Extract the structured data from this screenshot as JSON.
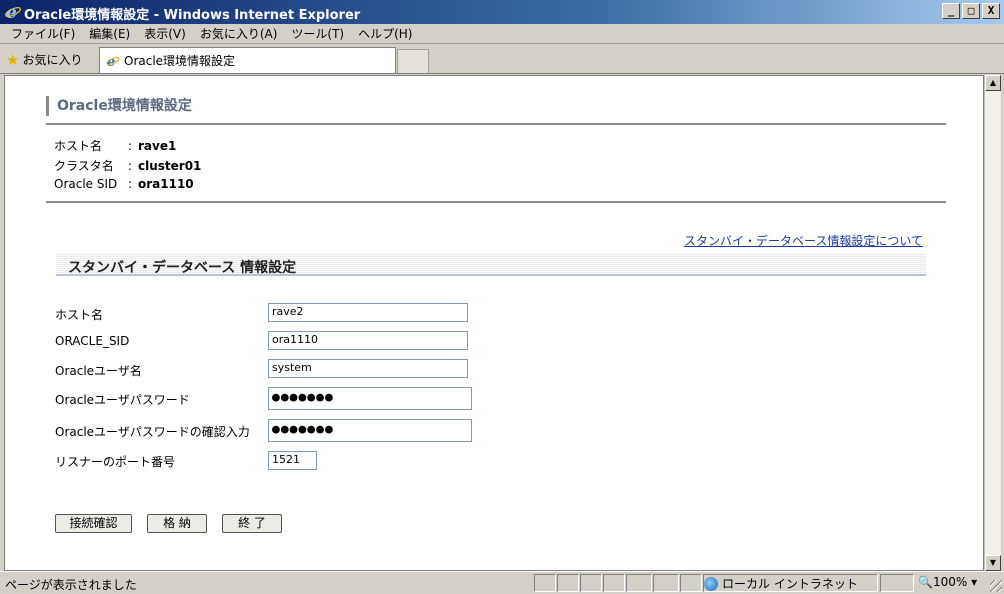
{
  "window": {
    "title": "Oracle環境情報設定 - Windows Internet Explorer",
    "min": "_",
    "max": "□",
    "close": "X"
  },
  "menu": [
    "ファイル(F)",
    "編集(E)",
    "表示(V)",
    "お気に入り(A)",
    "ツール(T)",
    "ヘルプ(H)"
  ],
  "tabbar": {
    "favorites": "お気に入り",
    "tab_title": "Oracle環境情報設定"
  },
  "page": {
    "title": "Oracle環境情報設定",
    "info": [
      {
        "label": "ホスト名",
        "value": "rave1"
      },
      {
        "label": "クラスタ名",
        "value": "cluster01"
      },
      {
        "label": "Oracle SID",
        "value": "ora1110"
      }
    ],
    "info_colon": ":",
    "help_link": "スタンバイ・データベース情報設定について",
    "section_title": "スタンバイ・データベース 情報設定",
    "form": {
      "host_label": "ホスト名",
      "host_value": "rave2",
      "sid_label": "ORACLE_SID",
      "sid_value": "ora1110",
      "user_label": "Oracleユーザ名",
      "user_value": "system",
      "pass_label": "Oracleユーザパスワード",
      "pass_value": "●●●●●●●",
      "pass_confirm_label": "Oracleユーザパスワードの確認入力",
      "pass_confirm_value": "●●●●●●●",
      "port_label": "リスナーのポート番号",
      "port_value": "1521"
    },
    "buttons": {
      "check": "接続確認",
      "save": "格 納",
      "exit": "終 了"
    }
  },
  "statusbar": {
    "text": "ページが表示されました",
    "zone": "ローカル イントラネット",
    "zoom": "100%"
  }
}
